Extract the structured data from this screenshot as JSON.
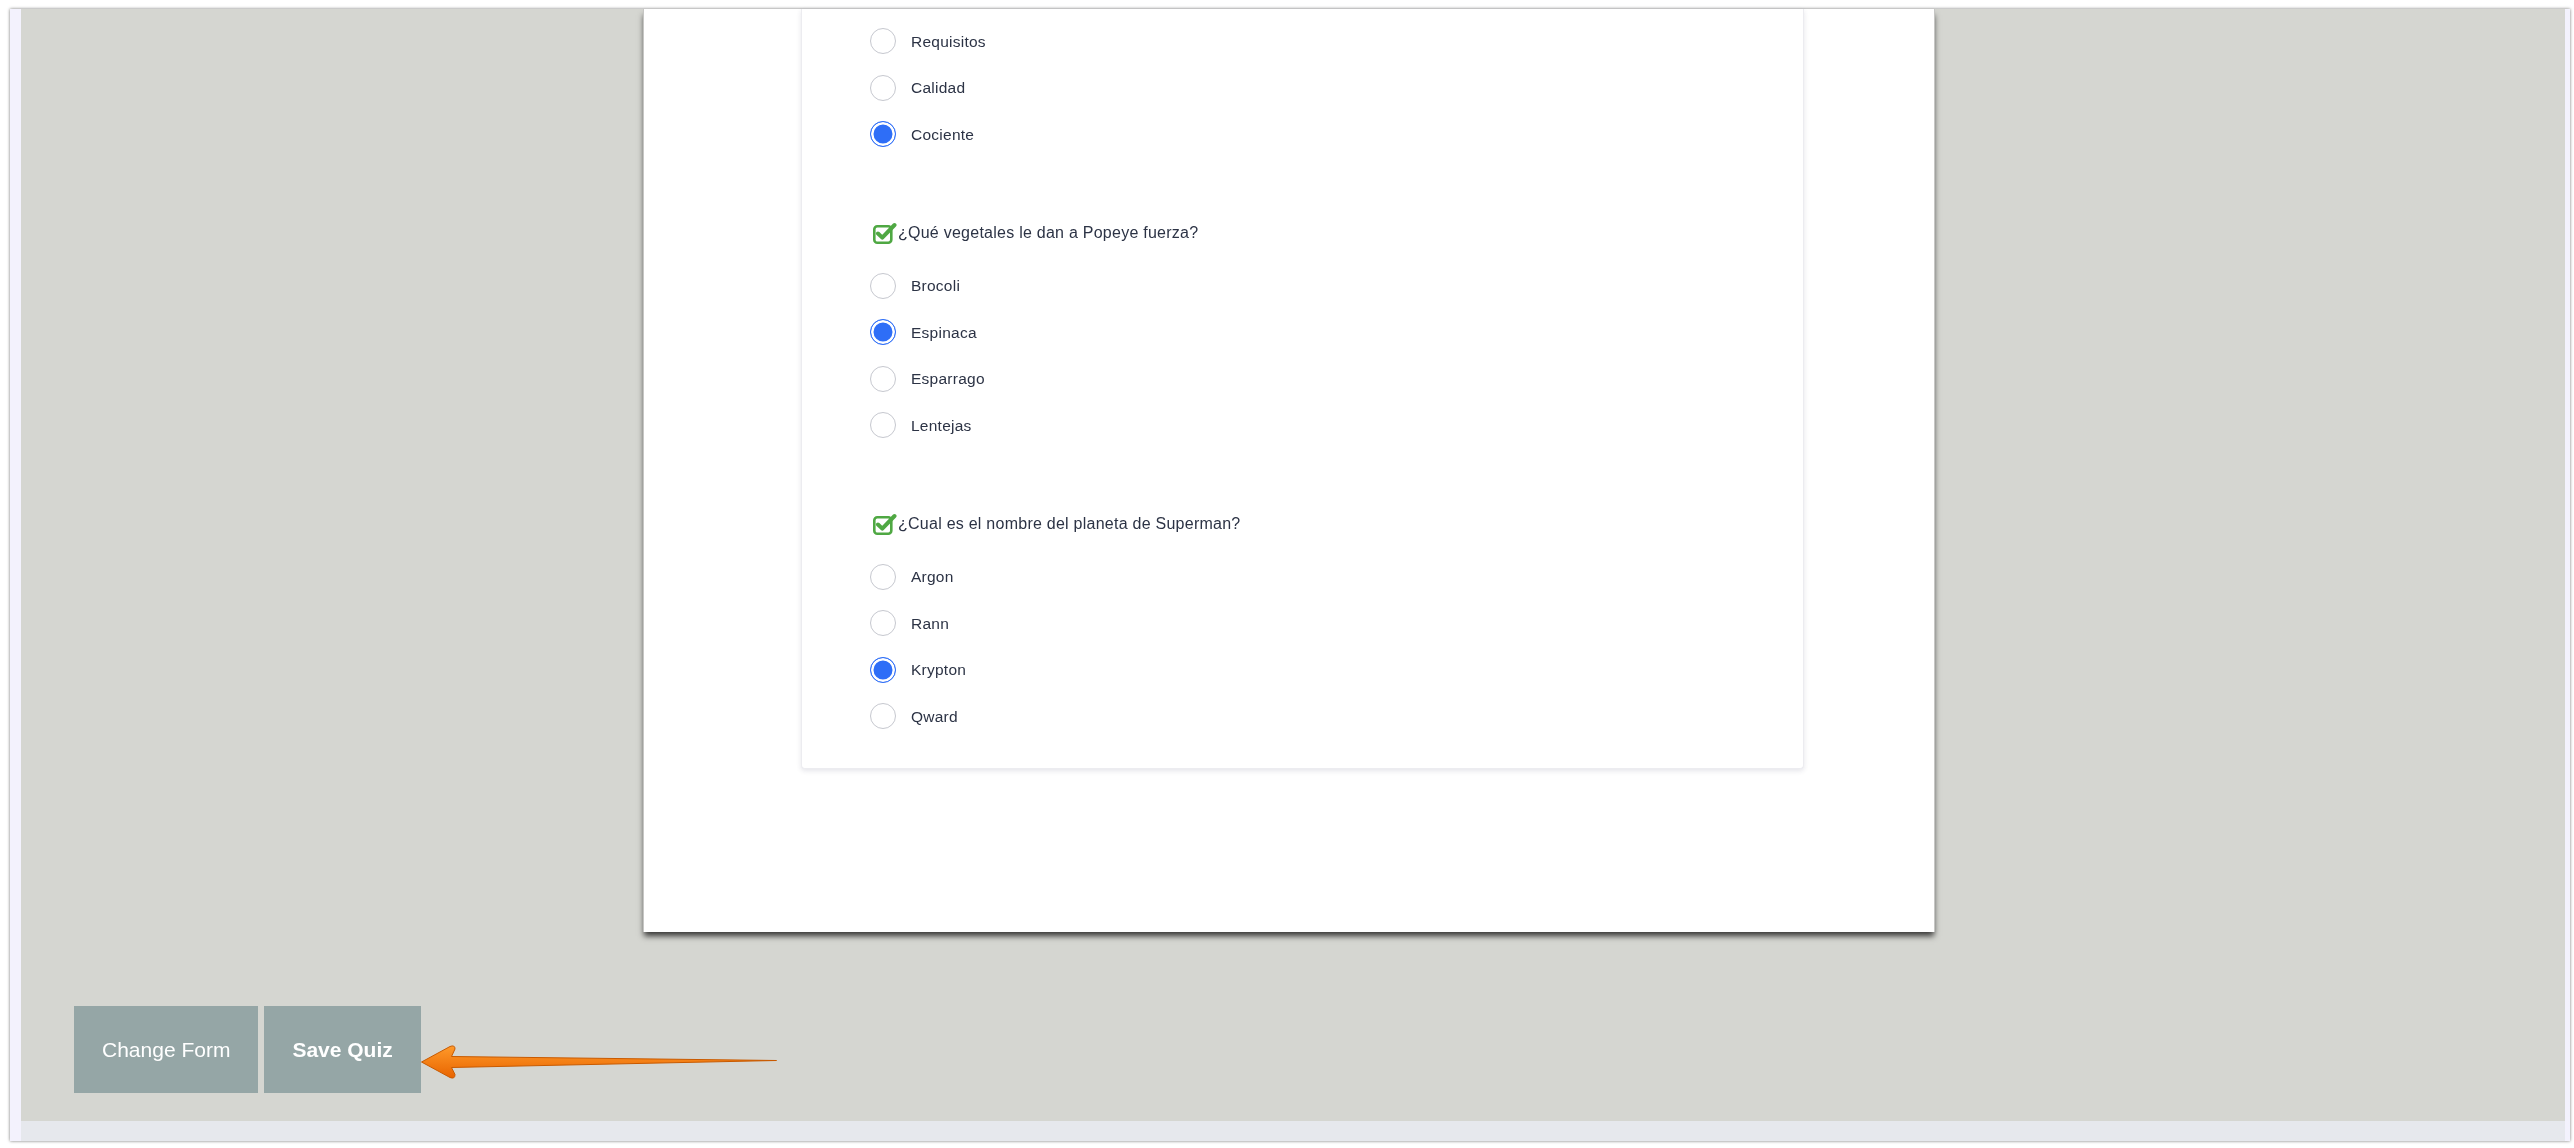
{
  "questions": [
    {
      "options": [
        {
          "label": "Requisitos",
          "selected": false
        },
        {
          "label": "Calidad",
          "selected": false
        },
        {
          "label": "Cociente",
          "selected": true
        }
      ]
    },
    {
      "title": "¿Qué vegetales le dan a Popeye fuerza?",
      "options": [
        {
          "label": "Brocoli",
          "selected": false
        },
        {
          "label": "Espinaca",
          "selected": true
        },
        {
          "label": "Esparrago",
          "selected": false
        },
        {
          "label": "Lentejas",
          "selected": false
        }
      ]
    },
    {
      "title": "¿Cual es el nombre del planeta de Superman?",
      "options": [
        {
          "label": "Argon",
          "selected": false
        },
        {
          "label": "Rann",
          "selected": false
        },
        {
          "label": "Krypton",
          "selected": true
        },
        {
          "label": "Qward",
          "selected": false
        }
      ]
    }
  ],
  "buttons": [
    {
      "label": "Change Form",
      "kind": "secondary"
    },
    {
      "label": "Save Quiz",
      "kind": "primary"
    }
  ]
}
